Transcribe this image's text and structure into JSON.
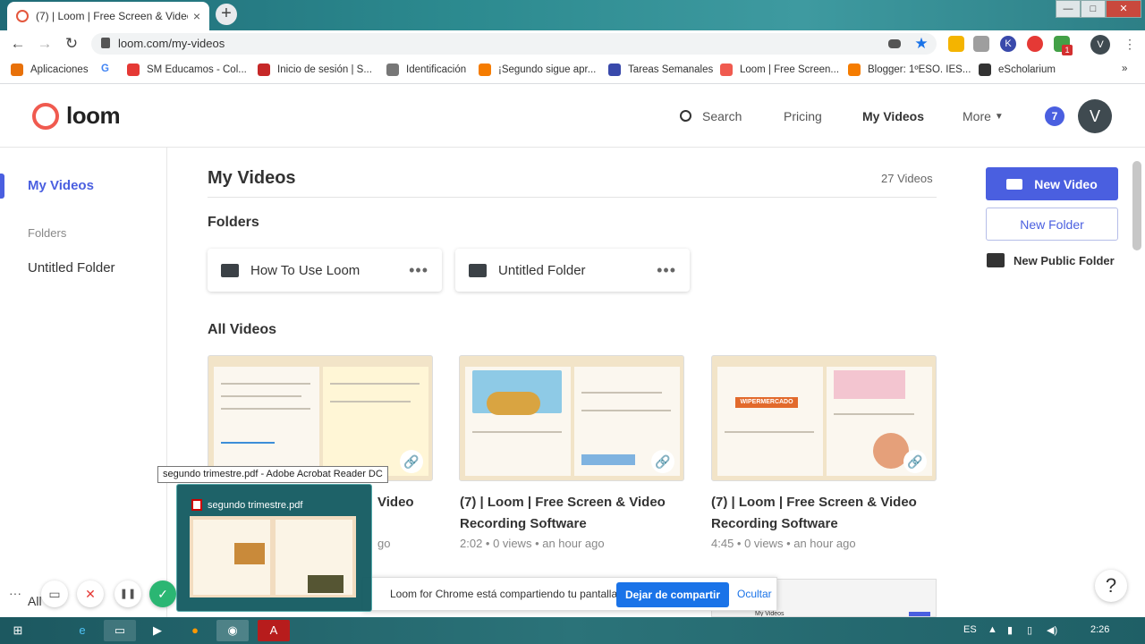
{
  "browser": {
    "tab_title": "(7) | Loom | Free Screen & Video",
    "tab_close": "×",
    "new_tab": "+",
    "url": "loom.com/my-videos",
    "nav": {
      "back": "←",
      "forward": "→",
      "reload": "↻"
    },
    "profile": "V",
    "window_controls": {
      "minimize": "—",
      "maximize": "□",
      "close": "✕"
    },
    "ext_badge": "1"
  },
  "bookmarks": [
    {
      "label": "Aplicaciones",
      "icon": "apps-icon",
      "color": "#e8710a"
    },
    {
      "label": "G",
      "icon": "google-icon",
      "color": "#ffffff"
    },
    {
      "label": "SM Educamos - Col...",
      "icon": "sm-icon",
      "color": "#e53935"
    },
    {
      "label": "Inicio de sesión | S...",
      "icon": "sm-login-icon",
      "color": "#c62828"
    },
    {
      "label": "Identificación",
      "icon": "globe-icon",
      "color": "#777777"
    },
    {
      "label": "¡Segundo sigue apr...",
      "icon": "blogger-icon",
      "color": "#f57c00"
    },
    {
      "label": "Tareas Semanales",
      "icon": "tasks-icon",
      "color": "#3949ab"
    },
    {
      "label": "Loom | Free Screen...",
      "icon": "loom-icon",
      "color": "#f05a4f"
    },
    {
      "label": "Blogger: 1ºESO. IES...",
      "icon": "blogger-icon",
      "color": "#f57c00"
    },
    {
      "label": "eScholarium",
      "icon": "escholarium-icon",
      "color": "#333333"
    }
  ],
  "loom": {
    "logo": "loom",
    "nav": {
      "search": "Search",
      "pricing": "Pricing",
      "my_videos": "My Videos",
      "more": "More"
    },
    "notifications": "7",
    "avatar": "V"
  },
  "sidebar": {
    "my_videos": "My Videos",
    "folders_label": "Folders",
    "folder_items": [
      "Untitled Folder"
    ],
    "bottom_label": "All"
  },
  "main": {
    "title": "My Videos",
    "count": "27 Videos",
    "folders_heading": "Folders",
    "folders": [
      {
        "name": "How To Use Loom",
        "menu": "•••"
      },
      {
        "name": "Untitled Folder",
        "menu": "•••"
      }
    ],
    "all_videos_heading": "All Videos",
    "videos": [
      {
        "title_line1": "",
        "title_visible_fragment": "Video",
        "meta_visible": "go"
      },
      {
        "title_line1": "(7) | Loom | Free Screen & Video",
        "title_line2": "Recording Software",
        "duration": "2:02",
        "views": "0 views",
        "age": "an hour ago"
      },
      {
        "title_line1": "(7) | Loom | Free Screen & Video",
        "title_line2": "Recording Software",
        "duration": "4:45",
        "views": "0 views",
        "age": "an hour ago"
      }
    ]
  },
  "actions": {
    "new_video": "New Video",
    "new_folder": "New Folder",
    "new_public_folder": "New Public Folder"
  },
  "share_bar": {
    "message": "Loom for Chrome está compartiendo tu pantalla.",
    "stop": "Dejar de compartir",
    "hide": "Ocultar"
  },
  "taskbar_preview": {
    "tooltip": "segundo trimestre.pdf - Adobe Acrobat Reader DC",
    "title": "segundo trimestre.pdf"
  },
  "recorder": {
    "more": "···",
    "cancel": "✕",
    "pause": "❚❚",
    "done": "✓"
  },
  "help": "?",
  "tray": {
    "lang": "ES",
    "time": "2:26"
  },
  "thumbnail_texts": {
    "wipermercado": "WIPERMERCADO",
    "my_videos_small": "My Videos"
  }
}
